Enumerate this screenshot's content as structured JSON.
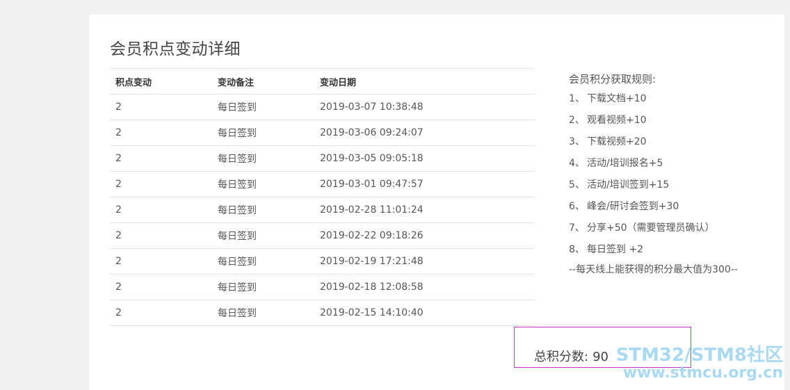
{
  "page_title": "会员积点变动详细",
  "table": {
    "headers": [
      "积点变动",
      "变动备注",
      "变动日期"
    ],
    "rows": [
      [
        "2",
        "每日签到",
        "2019-03-07 10:38:48"
      ],
      [
        "2",
        "每日签到",
        "2019-03-06 09:24:07"
      ],
      [
        "2",
        "每日签到",
        "2019-03-05 09:05:18"
      ],
      [
        "2",
        "每日签到",
        "2019-03-01 09:47:57"
      ],
      [
        "2",
        "每日签到",
        "2019-02-28 11:01:24"
      ],
      [
        "2",
        "每日签到",
        "2019-02-22 09:18:26"
      ],
      [
        "2",
        "每日签到",
        "2019-02-19 17:21:48"
      ],
      [
        "2",
        "每日签到",
        "2019-02-18 12:08:58"
      ],
      [
        "2",
        "每日签到",
        "2019-02-15 14:10:40"
      ]
    ]
  },
  "rules": {
    "title": "会员积分获取规则:",
    "items": [
      {
        "num": "1、",
        "text": "下载文档+10"
      },
      {
        "num": "2、",
        "text": "观看视频+10"
      },
      {
        "num": "3、",
        "text": "下载视频+20"
      },
      {
        "num": "4、",
        "text": "活动/培训报名+5"
      },
      {
        "num": "5、",
        "text": "活动/培训签到+15"
      },
      {
        "num": "6、",
        "text": "峰会/研讨会签到+30"
      },
      {
        "num": "7、",
        "text": "分享+50（需要管理员确认）"
      },
      {
        "num": "8、",
        "text": "每日签到 +2"
      }
    ],
    "footer": "--每天线上能获得的积分最大值为300--"
  },
  "total": {
    "label": "总积分数:",
    "value": "90"
  },
  "watermark": {
    "line1": "STM32/STM8社区",
    "line2": "www.stmcu.org.cn"
  }
}
